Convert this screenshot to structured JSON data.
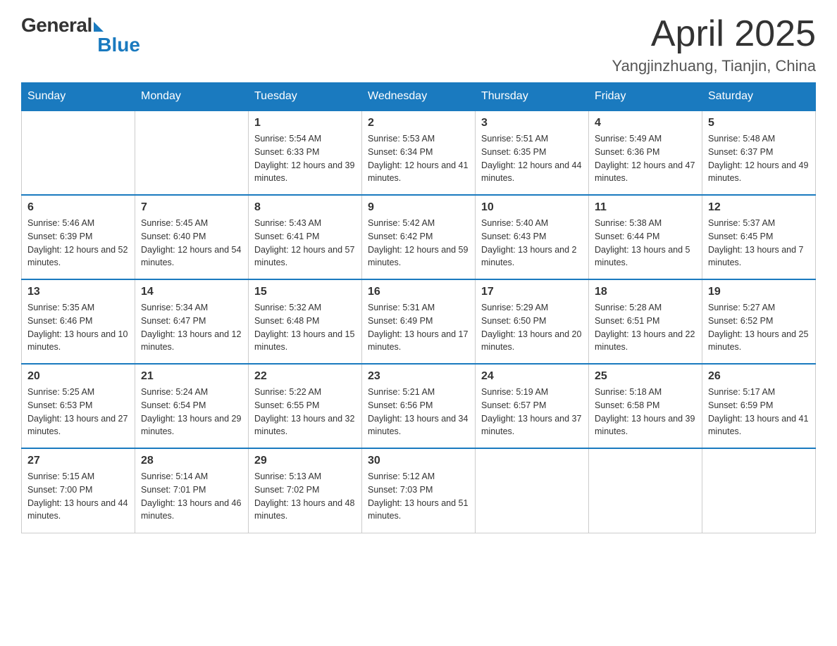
{
  "header": {
    "logo_general": "General",
    "logo_blue": "Blue",
    "month": "April 2025",
    "location": "Yangjinzhuang, Tianjin, China"
  },
  "days_of_week": [
    "Sunday",
    "Monday",
    "Tuesday",
    "Wednesday",
    "Thursday",
    "Friday",
    "Saturday"
  ],
  "weeks": [
    [
      {
        "day": "",
        "sunrise": "",
        "sunset": "",
        "daylight": ""
      },
      {
        "day": "",
        "sunrise": "",
        "sunset": "",
        "daylight": ""
      },
      {
        "day": "1",
        "sunrise": "Sunrise: 5:54 AM",
        "sunset": "Sunset: 6:33 PM",
        "daylight": "Daylight: 12 hours and 39 minutes."
      },
      {
        "day": "2",
        "sunrise": "Sunrise: 5:53 AM",
        "sunset": "Sunset: 6:34 PM",
        "daylight": "Daylight: 12 hours and 41 minutes."
      },
      {
        "day": "3",
        "sunrise": "Sunrise: 5:51 AM",
        "sunset": "Sunset: 6:35 PM",
        "daylight": "Daylight: 12 hours and 44 minutes."
      },
      {
        "day": "4",
        "sunrise": "Sunrise: 5:49 AM",
        "sunset": "Sunset: 6:36 PM",
        "daylight": "Daylight: 12 hours and 47 minutes."
      },
      {
        "day": "5",
        "sunrise": "Sunrise: 5:48 AM",
        "sunset": "Sunset: 6:37 PM",
        "daylight": "Daylight: 12 hours and 49 minutes."
      }
    ],
    [
      {
        "day": "6",
        "sunrise": "Sunrise: 5:46 AM",
        "sunset": "Sunset: 6:39 PM",
        "daylight": "Daylight: 12 hours and 52 minutes."
      },
      {
        "day": "7",
        "sunrise": "Sunrise: 5:45 AM",
        "sunset": "Sunset: 6:40 PM",
        "daylight": "Daylight: 12 hours and 54 minutes."
      },
      {
        "day": "8",
        "sunrise": "Sunrise: 5:43 AM",
        "sunset": "Sunset: 6:41 PM",
        "daylight": "Daylight: 12 hours and 57 minutes."
      },
      {
        "day": "9",
        "sunrise": "Sunrise: 5:42 AM",
        "sunset": "Sunset: 6:42 PM",
        "daylight": "Daylight: 12 hours and 59 minutes."
      },
      {
        "day": "10",
        "sunrise": "Sunrise: 5:40 AM",
        "sunset": "Sunset: 6:43 PM",
        "daylight": "Daylight: 13 hours and 2 minutes."
      },
      {
        "day": "11",
        "sunrise": "Sunrise: 5:38 AM",
        "sunset": "Sunset: 6:44 PM",
        "daylight": "Daylight: 13 hours and 5 minutes."
      },
      {
        "day": "12",
        "sunrise": "Sunrise: 5:37 AM",
        "sunset": "Sunset: 6:45 PM",
        "daylight": "Daylight: 13 hours and 7 minutes."
      }
    ],
    [
      {
        "day": "13",
        "sunrise": "Sunrise: 5:35 AM",
        "sunset": "Sunset: 6:46 PM",
        "daylight": "Daylight: 13 hours and 10 minutes."
      },
      {
        "day": "14",
        "sunrise": "Sunrise: 5:34 AM",
        "sunset": "Sunset: 6:47 PM",
        "daylight": "Daylight: 13 hours and 12 minutes."
      },
      {
        "day": "15",
        "sunrise": "Sunrise: 5:32 AM",
        "sunset": "Sunset: 6:48 PM",
        "daylight": "Daylight: 13 hours and 15 minutes."
      },
      {
        "day": "16",
        "sunrise": "Sunrise: 5:31 AM",
        "sunset": "Sunset: 6:49 PM",
        "daylight": "Daylight: 13 hours and 17 minutes."
      },
      {
        "day": "17",
        "sunrise": "Sunrise: 5:29 AM",
        "sunset": "Sunset: 6:50 PM",
        "daylight": "Daylight: 13 hours and 20 minutes."
      },
      {
        "day": "18",
        "sunrise": "Sunrise: 5:28 AM",
        "sunset": "Sunset: 6:51 PM",
        "daylight": "Daylight: 13 hours and 22 minutes."
      },
      {
        "day": "19",
        "sunrise": "Sunrise: 5:27 AM",
        "sunset": "Sunset: 6:52 PM",
        "daylight": "Daylight: 13 hours and 25 minutes."
      }
    ],
    [
      {
        "day": "20",
        "sunrise": "Sunrise: 5:25 AM",
        "sunset": "Sunset: 6:53 PM",
        "daylight": "Daylight: 13 hours and 27 minutes."
      },
      {
        "day": "21",
        "sunrise": "Sunrise: 5:24 AM",
        "sunset": "Sunset: 6:54 PM",
        "daylight": "Daylight: 13 hours and 29 minutes."
      },
      {
        "day": "22",
        "sunrise": "Sunrise: 5:22 AM",
        "sunset": "Sunset: 6:55 PM",
        "daylight": "Daylight: 13 hours and 32 minutes."
      },
      {
        "day": "23",
        "sunrise": "Sunrise: 5:21 AM",
        "sunset": "Sunset: 6:56 PM",
        "daylight": "Daylight: 13 hours and 34 minutes."
      },
      {
        "day": "24",
        "sunrise": "Sunrise: 5:19 AM",
        "sunset": "Sunset: 6:57 PM",
        "daylight": "Daylight: 13 hours and 37 minutes."
      },
      {
        "day": "25",
        "sunrise": "Sunrise: 5:18 AM",
        "sunset": "Sunset: 6:58 PM",
        "daylight": "Daylight: 13 hours and 39 minutes."
      },
      {
        "day": "26",
        "sunrise": "Sunrise: 5:17 AM",
        "sunset": "Sunset: 6:59 PM",
        "daylight": "Daylight: 13 hours and 41 minutes."
      }
    ],
    [
      {
        "day": "27",
        "sunrise": "Sunrise: 5:15 AM",
        "sunset": "Sunset: 7:00 PM",
        "daylight": "Daylight: 13 hours and 44 minutes."
      },
      {
        "day": "28",
        "sunrise": "Sunrise: 5:14 AM",
        "sunset": "Sunset: 7:01 PM",
        "daylight": "Daylight: 13 hours and 46 minutes."
      },
      {
        "day": "29",
        "sunrise": "Sunrise: 5:13 AM",
        "sunset": "Sunset: 7:02 PM",
        "daylight": "Daylight: 13 hours and 48 minutes."
      },
      {
        "day": "30",
        "sunrise": "Sunrise: 5:12 AM",
        "sunset": "Sunset: 7:03 PM",
        "daylight": "Daylight: 13 hours and 51 minutes."
      },
      {
        "day": "",
        "sunrise": "",
        "sunset": "",
        "daylight": ""
      },
      {
        "day": "",
        "sunrise": "",
        "sunset": "",
        "daylight": ""
      },
      {
        "day": "",
        "sunrise": "",
        "sunset": "",
        "daylight": ""
      }
    ]
  ]
}
